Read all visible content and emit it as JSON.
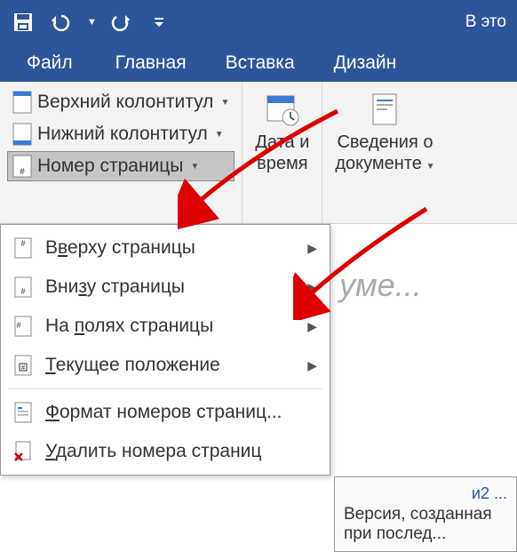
{
  "titlebar": {
    "right_text": "В это"
  },
  "tabs": [
    "Файл",
    "Главная",
    "Вставка",
    "Дизайн"
  ],
  "ribbon": {
    "header_top": "Верхний колонтитул",
    "header_bottom": "Нижний колонтитул",
    "page_number": "Номер страницы",
    "date_time_l1": "Дата и",
    "date_time_l2": "время",
    "docinfo_l1": "Сведения о",
    "docinfo_l2": "документе"
  },
  "menu": {
    "top_of_page": {
      "pre": "В",
      "u": "в",
      "post": "ерху страницы"
    },
    "bottom_of_page": {
      "pre": "Вни",
      "u": "з",
      "post": "у страницы"
    },
    "page_margins": {
      "pre": "На ",
      "u": "п",
      "post": "олях страницы"
    },
    "current_pos": {
      "pre": "",
      "u": "Т",
      "post": "екущее положение"
    },
    "format": {
      "pre": "",
      "u": "Ф",
      "post": "ормат номеров страниц..."
    },
    "remove": {
      "pre": "",
      "u": "У",
      "post": "далить номера страниц"
    }
  },
  "doc_placeholder": "уме...",
  "docbox_l1": "и2 ...",
  "docbox_l2": "Версия, созданная при послед..."
}
